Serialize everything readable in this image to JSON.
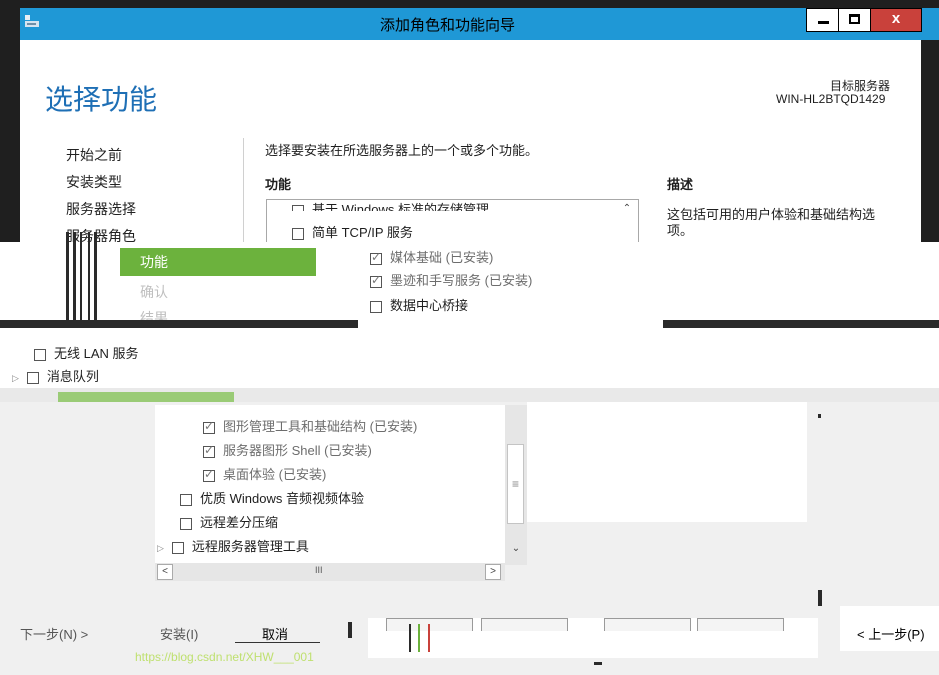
{
  "window": {
    "title": "添加角色和功能向导",
    "minimize_glyph": "_",
    "maximize_glyph": "□",
    "close_glyph": "x",
    "accent_color": "#1f98d6"
  },
  "header": {
    "page_title": "选择功能",
    "target_label": "目标服务器",
    "target_name": "WIN-HL2BTQD1429"
  },
  "nav": {
    "items": [
      {
        "label": "开始之前"
      },
      {
        "label": "安装类型"
      },
      {
        "label": "服务器选择"
      },
      {
        "label": "服务器角色"
      },
      {
        "label": "功能"
      },
      {
        "label": "确认"
      },
      {
        "label": "结果"
      }
    ],
    "selected_color": "#6cb23d"
  },
  "main": {
    "instruction": "选择要安装在所选服务器上的一个或多个功能。",
    "features_heading": "功能",
    "description_heading": "描述",
    "description_text_line1": "这包括可用的用户体验和基础结构选",
    "description_text_line2": "项。",
    "top_items": [
      {
        "label": "基于 Windows 标准的存储管理",
        "checked": false
      },
      {
        "label": "简单 TCP/IP 服务",
        "checked": false
      }
    ],
    "mid_items": [
      {
        "label": "媒体基础 (已安装)",
        "checked": true
      },
      {
        "label": "墨迹和手写服务 (已安装)",
        "checked": true
      },
      {
        "label": "数据中心桥接",
        "checked": false
      }
    ],
    "left_items": [
      {
        "label": "无线 LAN 服务",
        "checked": false
      },
      {
        "label": "消息队列",
        "checked": false
      }
    ],
    "lower_items": [
      {
        "label": "图形管理工具和基础结构 (已安装)",
        "checked": true
      },
      {
        "label": "服务器图形 Shell (已安装)",
        "checked": true
      },
      {
        "label": "桌面体验 (已安装)",
        "checked": true
      },
      {
        "label": "优质 Windows 音频视频体验",
        "checked": false
      },
      {
        "label": "远程差分压缩",
        "checked": false
      },
      {
        "label": "远程服务器管理工具",
        "checked": false
      }
    ],
    "scroll_thumb_glyph": "≡",
    "hscroll_thumb_glyph": "III"
  },
  "footer": {
    "next_button": "下一步(N) >",
    "install_button": "安装(I)",
    "cancel_button": "取消",
    "prev_button": "< 上一步(P)",
    "watermark": "https://blog.csdn.net/XHW___001"
  }
}
